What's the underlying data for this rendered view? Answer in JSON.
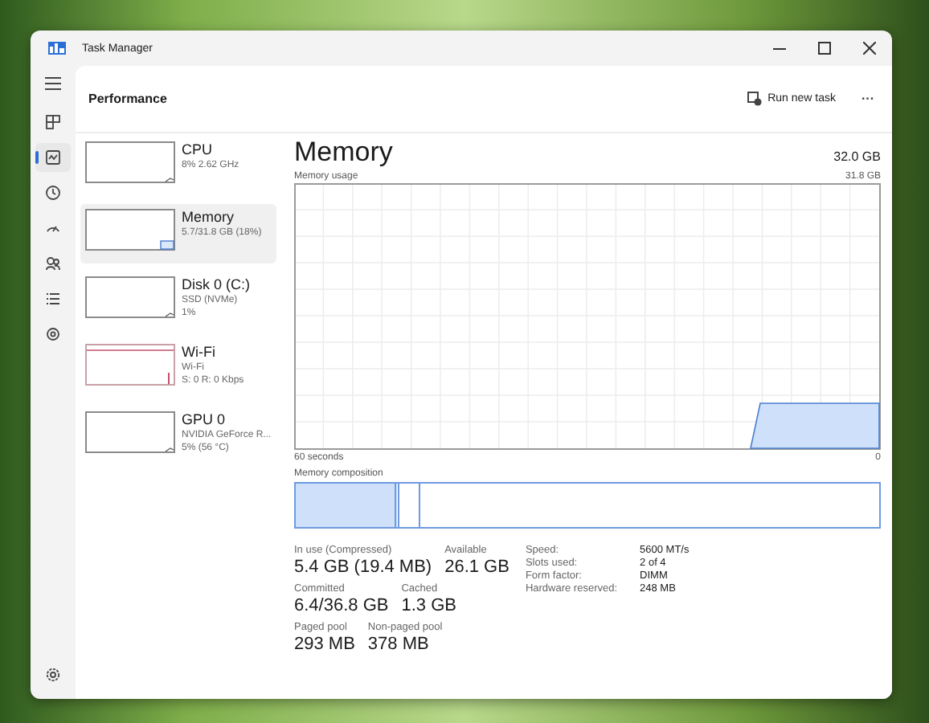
{
  "window": {
    "title": "Task Manager"
  },
  "nav": [
    {
      "selected": false
    },
    {
      "selected": true
    },
    {
      "selected": false
    },
    {
      "selected": false
    },
    {
      "selected": false
    },
    {
      "selected": false
    },
    {
      "selected": false
    },
    {
      "selected": false
    }
  ],
  "header": {
    "title": "Performance",
    "run_new_task": "Run new task",
    "more": "···"
  },
  "devices": [
    {
      "kind": "cpu",
      "name": "CPU",
      "lines": [
        "8% 2.62 GHz"
      ],
      "selected": false
    },
    {
      "kind": "memory",
      "name": "Memory",
      "lines": [
        "5.7/31.8 GB (18%)"
      ],
      "selected": true
    },
    {
      "kind": "disk",
      "name": "Disk 0 (C:)",
      "lines": [
        "SSD (NVMe)",
        "1%"
      ],
      "selected": false
    },
    {
      "kind": "wifi",
      "name": "Wi-Fi",
      "lines": [
        "Wi-Fi",
        "S: 0 R: 0 Kbps"
      ],
      "selected": false
    },
    {
      "kind": "gpu",
      "name": "GPU 0",
      "lines": [
        "NVIDIA GeForce R...",
        "5% (56 °C)"
      ],
      "selected": false
    }
  ],
  "main": {
    "title": "Memory",
    "total": "32.0 GB",
    "usage_label": "Memory usage",
    "usage_max": "31.8 GB",
    "time_label": "60 seconds",
    "time_end": "0",
    "composition_label": "Memory composition",
    "stats": [
      {
        "label": "In use (Compressed)",
        "value": "5.4 GB (19.4 MB)"
      },
      {
        "label": "Available",
        "value": "26.1 GB"
      },
      {
        "label": "Committed",
        "value": "6.4/36.8 GB"
      },
      {
        "label": "Cached",
        "value": "1.3 GB"
      },
      {
        "label": "Paged pool",
        "value": "293 MB"
      },
      {
        "label": "Non-paged pool",
        "value": "378 MB"
      }
    ],
    "details": [
      {
        "label": "Speed:",
        "value": "5600 MT/s"
      },
      {
        "label": "Slots used:",
        "value": "2 of 4"
      },
      {
        "label": "Form factor:",
        "value": "DIMM"
      },
      {
        "label": "Hardware reserved:",
        "value": "248 MB"
      }
    ]
  }
}
